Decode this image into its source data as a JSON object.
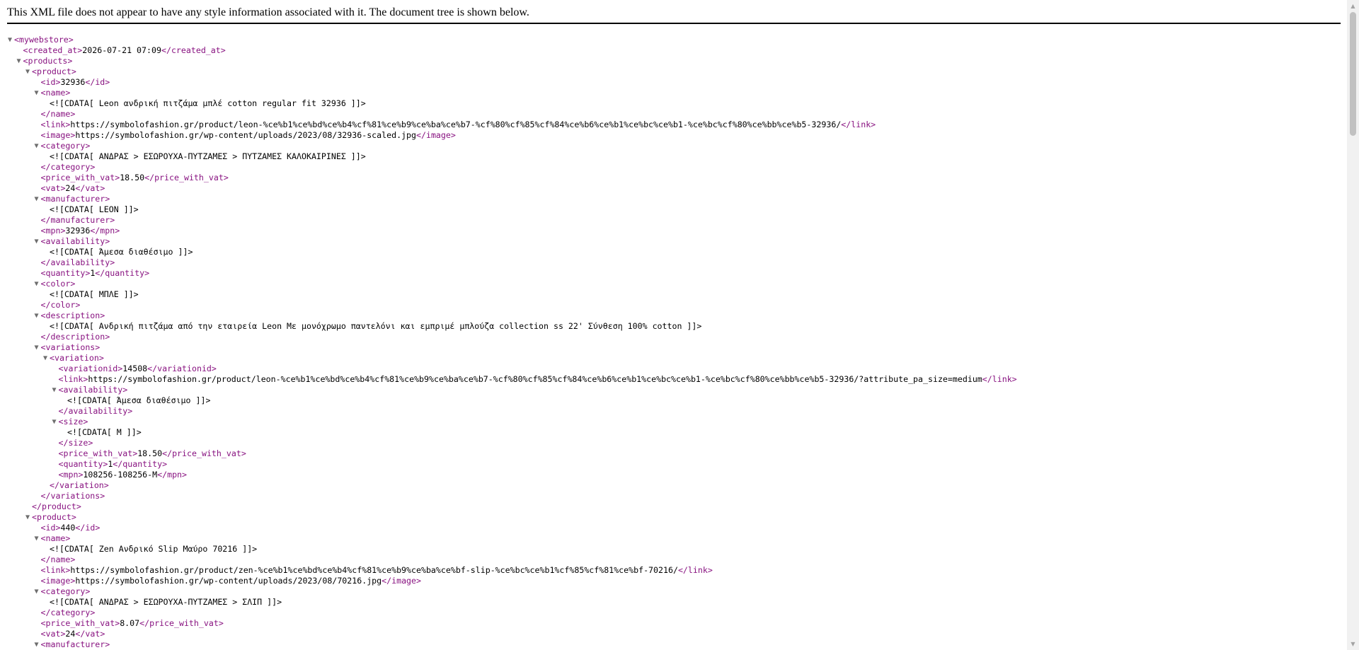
{
  "notice": "This XML file does not appear to have any style information associated with it. The document tree is shown below.",
  "scrollbar": {
    "up_icon": "arrow-up-icon",
    "down_icon": "arrow-down-icon"
  },
  "xml_lines": [
    {
      "indent": 0,
      "toggle": true,
      "open": "mywebstore",
      "text": "",
      "close": ""
    },
    {
      "indent": 1,
      "toggle": false,
      "open": "created_at",
      "text": "2026-07-21 07:09",
      "close": "created_at"
    },
    {
      "indent": 1,
      "toggle": true,
      "open": "products",
      "text": "",
      "close": ""
    },
    {
      "indent": 2,
      "toggle": true,
      "open": "product",
      "text": "",
      "close": ""
    },
    {
      "indent": 3,
      "toggle": false,
      "open": "id",
      "text": "32936",
      "close": "id"
    },
    {
      "indent": 3,
      "toggle": true,
      "open": "name",
      "text": "",
      "close": ""
    },
    {
      "indent": 4,
      "toggle": false,
      "open": "",
      "text": "<![CDATA[ Leon ανδρική πιτζάμα μπλέ cotton regular fit 32936 ]]>",
      "close": ""
    },
    {
      "indent": 3,
      "toggle": false,
      "open": "",
      "text": "",
      "close": "name"
    },
    {
      "indent": 3,
      "toggle": false,
      "open": "link",
      "text": "https://symbolofashion.gr/product/leon-%ce%b1%ce%bd%ce%b4%cf%81%ce%b9%ce%ba%ce%b7-%cf%80%cf%85%cf%84%ce%b6%ce%b1%ce%bc%ce%b1-%ce%bc%cf%80%ce%bb%ce%b5-32936/",
      "close": "link"
    },
    {
      "indent": 3,
      "toggle": false,
      "open": "image",
      "text": "https://symbolofashion.gr/wp-content/uploads/2023/08/32936-scaled.jpg",
      "close": "image"
    },
    {
      "indent": 3,
      "toggle": true,
      "open": "category",
      "text": "",
      "close": ""
    },
    {
      "indent": 4,
      "toggle": false,
      "open": "",
      "text": "<![CDATA[ ΑΝΔΡΑΣ > ΕΣΩΡΟΥΧΑ-ΠΥΤΖΑΜΕΣ > ΠΥΤΖΑΜΕΣ ΚΑΛΟΚΑΙΡΙΝΕΣ ]]>",
      "close": ""
    },
    {
      "indent": 3,
      "toggle": false,
      "open": "",
      "text": "",
      "close": "category"
    },
    {
      "indent": 3,
      "toggle": false,
      "open": "price_with_vat",
      "text": "18.50",
      "close": "price_with_vat"
    },
    {
      "indent": 3,
      "toggle": false,
      "open": "vat",
      "text": "24",
      "close": "vat"
    },
    {
      "indent": 3,
      "toggle": true,
      "open": "manufacturer",
      "text": "",
      "close": ""
    },
    {
      "indent": 4,
      "toggle": false,
      "open": "",
      "text": "<![CDATA[ LEON ]]>",
      "close": ""
    },
    {
      "indent": 3,
      "toggle": false,
      "open": "",
      "text": "",
      "close": "manufacturer"
    },
    {
      "indent": 3,
      "toggle": false,
      "open": "mpn",
      "text": "32936",
      "close": "mpn"
    },
    {
      "indent": 3,
      "toggle": true,
      "open": "availability",
      "text": "",
      "close": ""
    },
    {
      "indent": 4,
      "toggle": false,
      "open": "",
      "text": "<![CDATA[ Άμεσα διαθέσιμο ]]>",
      "close": ""
    },
    {
      "indent": 3,
      "toggle": false,
      "open": "",
      "text": "",
      "close": "availability"
    },
    {
      "indent": 3,
      "toggle": false,
      "open": "quantity",
      "text": "1",
      "close": "quantity"
    },
    {
      "indent": 3,
      "toggle": true,
      "open": "color",
      "text": "",
      "close": ""
    },
    {
      "indent": 4,
      "toggle": false,
      "open": "",
      "text": "<![CDATA[ ΜΠΛΕ ]]>",
      "close": ""
    },
    {
      "indent": 3,
      "toggle": false,
      "open": "",
      "text": "",
      "close": "color"
    },
    {
      "indent": 3,
      "toggle": true,
      "open": "description",
      "text": "",
      "close": ""
    },
    {
      "indent": 4,
      "toggle": false,
      "open": "",
      "text": "<![CDATA[ Ανδρική πιτζάμα από την εταιρεία Leon Με μονόχρωμο παντελόνι και εμπριμέ μπλούζα collection ss 22' Σύνθεση 100% cotton ]]>",
      "close": ""
    },
    {
      "indent": 3,
      "toggle": false,
      "open": "",
      "text": "",
      "close": "description"
    },
    {
      "indent": 3,
      "toggle": true,
      "open": "variations",
      "text": "",
      "close": ""
    },
    {
      "indent": 4,
      "toggle": true,
      "open": "variation",
      "text": "",
      "close": ""
    },
    {
      "indent": 5,
      "toggle": false,
      "open": "variationid",
      "text": "14508",
      "close": "variationid"
    },
    {
      "indent": 5,
      "toggle": false,
      "open": "link",
      "text": "https://symbolofashion.gr/product/leon-%ce%b1%ce%bd%ce%b4%cf%81%ce%b9%ce%ba%ce%b7-%cf%80%cf%85%cf%84%ce%b6%ce%b1%ce%bc%ce%b1-%ce%bc%cf%80%ce%bb%ce%b5-32936/?attribute_pa_size=medium",
      "close": "link"
    },
    {
      "indent": 5,
      "toggle": true,
      "open": "availability",
      "text": "",
      "close": ""
    },
    {
      "indent": 6,
      "toggle": false,
      "open": "",
      "text": "<![CDATA[ Άμεσα διαθέσιμο ]]>",
      "close": ""
    },
    {
      "indent": 5,
      "toggle": false,
      "open": "",
      "text": "",
      "close": "availability"
    },
    {
      "indent": 5,
      "toggle": true,
      "open": "size",
      "text": "",
      "close": ""
    },
    {
      "indent": 6,
      "toggle": false,
      "open": "",
      "text": "<![CDATA[ M ]]>",
      "close": ""
    },
    {
      "indent": 5,
      "toggle": false,
      "open": "",
      "text": "",
      "close": "size"
    },
    {
      "indent": 5,
      "toggle": false,
      "open": "price_with_vat",
      "text": "18.50",
      "close": "price_with_vat"
    },
    {
      "indent": 5,
      "toggle": false,
      "open": "quantity",
      "text": "1",
      "close": "quantity"
    },
    {
      "indent": 5,
      "toggle": false,
      "open": "mpn",
      "text": "108256-108256-M",
      "close": "mpn"
    },
    {
      "indent": 4,
      "toggle": false,
      "open": "",
      "text": "",
      "close": "variation"
    },
    {
      "indent": 3,
      "toggle": false,
      "open": "",
      "text": "",
      "close": "variations"
    },
    {
      "indent": 2,
      "toggle": false,
      "open": "",
      "text": "",
      "close": "product"
    },
    {
      "indent": 2,
      "toggle": true,
      "open": "product",
      "text": "",
      "close": ""
    },
    {
      "indent": 3,
      "toggle": false,
      "open": "id",
      "text": "440",
      "close": "id"
    },
    {
      "indent": 3,
      "toggle": true,
      "open": "name",
      "text": "",
      "close": ""
    },
    {
      "indent": 4,
      "toggle": false,
      "open": "",
      "text": "<![CDATA[ Zen Ανδρικό Slip Μαύρο 70216 ]]>",
      "close": ""
    },
    {
      "indent": 3,
      "toggle": false,
      "open": "",
      "text": "",
      "close": "name"
    },
    {
      "indent": 3,
      "toggle": false,
      "open": "link",
      "text": "https://symbolofashion.gr/product/zen-%ce%b1%ce%bd%ce%b4%cf%81%ce%b9%ce%ba%ce%bf-slip-%ce%bc%ce%b1%cf%85%cf%81%ce%bf-70216/",
      "close": "link"
    },
    {
      "indent": 3,
      "toggle": false,
      "open": "image",
      "text": "https://symbolofashion.gr/wp-content/uploads/2023/08/70216.jpg",
      "close": "image"
    },
    {
      "indent": 3,
      "toggle": true,
      "open": "category",
      "text": "",
      "close": ""
    },
    {
      "indent": 4,
      "toggle": false,
      "open": "",
      "text": "<![CDATA[ ΑΝΔΡΑΣ > ΕΣΩΡΟΥΧΑ-ΠΥΤΖΑΜΕΣ > ΣΛΙΠ ]]>",
      "close": ""
    },
    {
      "indent": 3,
      "toggle": false,
      "open": "",
      "text": "",
      "close": "category"
    },
    {
      "indent": 3,
      "toggle": false,
      "open": "price_with_vat",
      "text": "8.07",
      "close": "price_with_vat"
    },
    {
      "indent": 3,
      "toggle": false,
      "open": "vat",
      "text": "24",
      "close": "vat"
    },
    {
      "indent": 3,
      "toggle": true,
      "open": "manufacturer",
      "text": "",
      "close": ""
    }
  ]
}
